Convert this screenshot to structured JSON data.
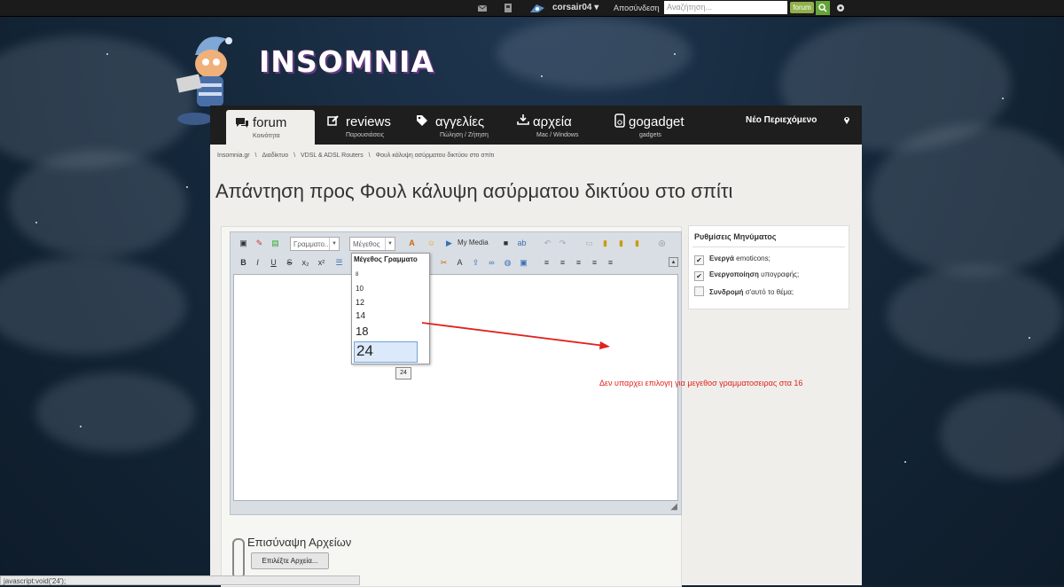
{
  "topbar": {
    "username": "corsair04",
    "logout": "Αποσύνδεση",
    "search_placeholder": "Αναζήτηση...",
    "search_scope": "forum",
    "icons": [
      "envelope-icon",
      "bookmark-icon",
      "user-avatar",
      "search-icon",
      "gear-icon"
    ]
  },
  "brand": {
    "logo_text": "INSOMNIA"
  },
  "nav": {
    "tabs": [
      {
        "label": "forum",
        "sub": "Κοινότητα",
        "icon": "comments-icon",
        "active": true
      },
      {
        "label": "reviews",
        "sub": "Παρουσιάσεις",
        "icon": "edit-icon"
      },
      {
        "label": "αγγελίες",
        "sub": "Πώληση / Ζήτηση",
        "icon": "tag-icon"
      },
      {
        "label": "αρχεία",
        "sub": "Mac / Windows",
        "icon": "download-icon"
      },
      {
        "label": "gogadget",
        "sub": "gadgets",
        "icon": "ipod-icon"
      }
    ],
    "new_content": "Νέο Περιεχόμενο"
  },
  "breadcrumb": {
    "items": [
      "Insomnia.gr",
      "Διαδίκτυο",
      "VDSL & ADSL Routers",
      "Φουλ κάλυψη ασύρματου δικτύου στο σπίτι"
    ],
    "sep": "\\"
  },
  "page": {
    "title": "Απάντηση προς Φουλ κάλυψη ασύρματου δικτύου στο σπίτι"
  },
  "editor": {
    "font_select": "Γραμματο...",
    "size_select": "Μέγεθος",
    "my_media": "My Media",
    "format_buttons": [
      "B",
      "I",
      "U",
      "S",
      "x₂",
      "x²"
    ]
  },
  "size_dropdown": {
    "header": "Μέγεθος Γραμματο",
    "options": [
      "8",
      "10",
      "12",
      "14",
      "18",
      "24"
    ],
    "selected": "24",
    "tooltip": "24"
  },
  "annotation": {
    "text": "Δεν υπαρχει επιλογη για μεγεθοσ γραμματοσειρας στα 16",
    "color": "#e0221e"
  },
  "settings": {
    "title": "Ρυθμίσεις Μηνύματος",
    "options": [
      {
        "bold": "Ενεργά",
        "rest": " emoticons;",
        "checked": true
      },
      {
        "bold": "Ενεργοποίηση",
        "rest": " υπογραφής;",
        "checked": true
      },
      {
        "bold": "Συνδρομή",
        "rest": " σ'αυτό το θέμα;",
        "checked": false
      }
    ]
  },
  "attachments": {
    "title": "Επισύναψη Αρχείων",
    "button": "Επιλέξτε Αρχεία..."
  },
  "statusbar": {
    "text": "javascript:void('24');"
  },
  "colors": {
    "accent_green": "#66a338",
    "nav_bg": "#1e1e1e",
    "panel_bg": "#efeeea"
  }
}
